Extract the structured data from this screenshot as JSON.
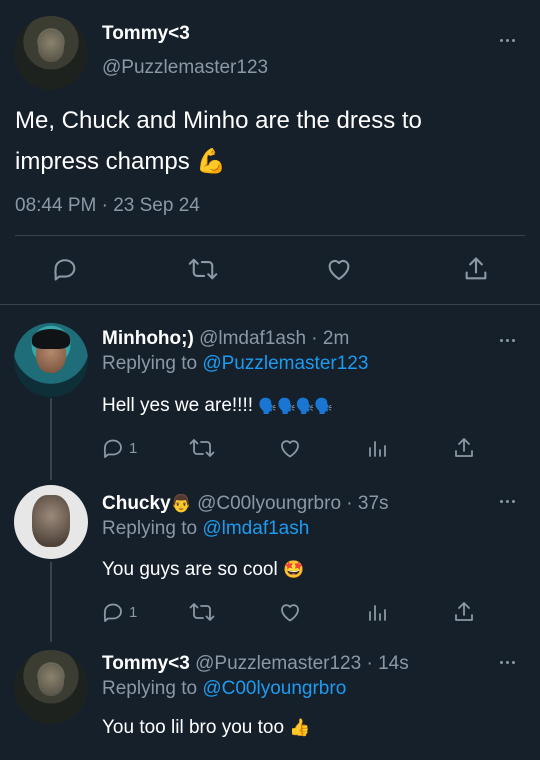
{
  "main": {
    "name": "Tommy<3",
    "handle": "@Puzzlemaster123",
    "text_line1": "Me, Chuck and Minho are the dress to",
    "text_line2": "impress champs",
    "text_emoji": "💪",
    "timestamp": "08:44 PM · 23 Sep 24",
    "actions": [
      "reply-icon",
      "retweet-icon",
      "like-icon",
      "share-icon"
    ]
  },
  "replies": [
    {
      "name": "Minhoho;)",
      "handle_time": "@lmdaf1ash · 2m",
      "replying_prefix": "Replying to",
      "replying_to": "@Puzzlemaster123",
      "text": "Hell yes we are!!!!",
      "text_emoji": "🗣️🗣️🗣️🗣️",
      "reply_count": "1"
    },
    {
      "name": "Chucky",
      "name_emoji": "👨",
      "handle_time": "@C00lyoungrbro · 37s",
      "replying_prefix": "Replying to",
      "replying_to": "@lmdaf1ash",
      "text": "You guys are so cool",
      "text_emoji": "🤩",
      "reply_count": "1"
    },
    {
      "name": "Tommy<3",
      "handle_time": "@Puzzlemaster123 · 14s",
      "replying_prefix": "Replying to",
      "replying_to": "@C00lyoungrbro",
      "text": "You too lil bro you too",
      "text_emoji": "👍"
    }
  ],
  "colors": {
    "background": "#15202b",
    "muted": "#8b98a5",
    "link": "#1d9bf0",
    "divider": "#38444d"
  }
}
